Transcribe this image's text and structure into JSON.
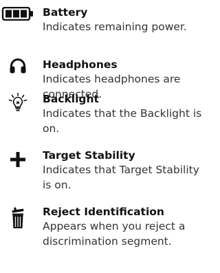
{
  "entries": [
    {
      "icon": "battery-icon",
      "title": "Battery",
      "description": "Indicates remaining power."
    },
    {
      "icon": "headphones-icon",
      "title": "Headphones",
      "description": "Indicates headphones are connected."
    },
    {
      "icon": "backlight-icon",
      "title": "Backlight",
      "description": "Indicates that the Backlight is on."
    },
    {
      "icon": "target-stability-icon",
      "title": "Target Stability",
      "description": "Indicates that Target Stability is on."
    },
    {
      "icon": "trash-icon",
      "title": "Reject Identification",
      "description": "Appears when you reject a discrimination segment."
    }
  ]
}
